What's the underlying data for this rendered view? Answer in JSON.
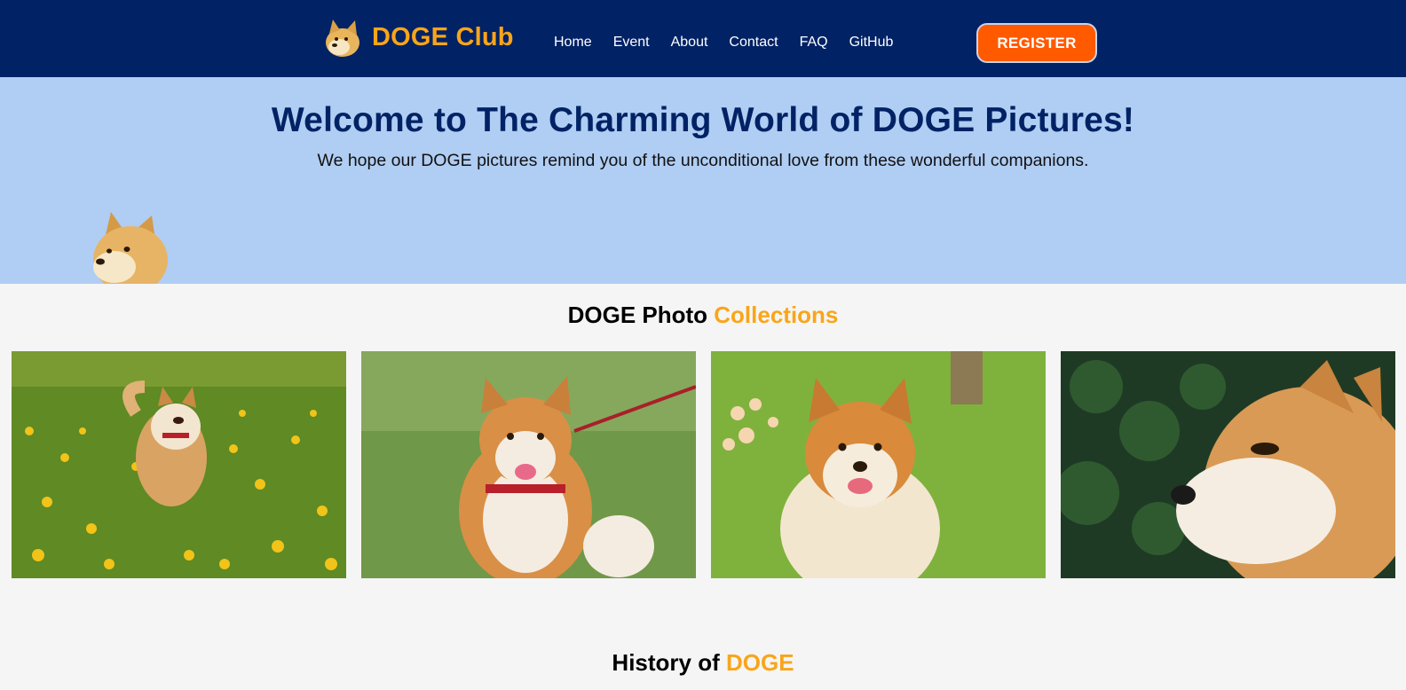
{
  "header": {
    "logo_text": "DOGE Club",
    "nav": [
      "Home",
      "Event",
      "About",
      "Contact",
      "FAQ",
      "GitHub"
    ],
    "register_label": "REGISTER"
  },
  "hero": {
    "title": "Welcome to The Charming World of DOGE Pictures!",
    "subtitle": "We hope our DOGE pictures remind you of the unconditional love from these wonderful companions."
  },
  "collections": {
    "title_part1": "DOGE Photo",
    "title_part2": "Collections",
    "photos": [
      "shiba-in-flower-field",
      "shiba-on-leash-in-grass",
      "shiba-smiling-in-garden",
      "shiba-side-profile"
    ]
  },
  "history": {
    "title_part1": "History of",
    "title_part2": "DOGE"
  },
  "colors": {
    "header_bg": "#012265",
    "accent": "#f9a51a",
    "hero_bg": "#b0cdf3",
    "register_bg": "#ff5a00",
    "page_bg": "#f5f5f5"
  }
}
